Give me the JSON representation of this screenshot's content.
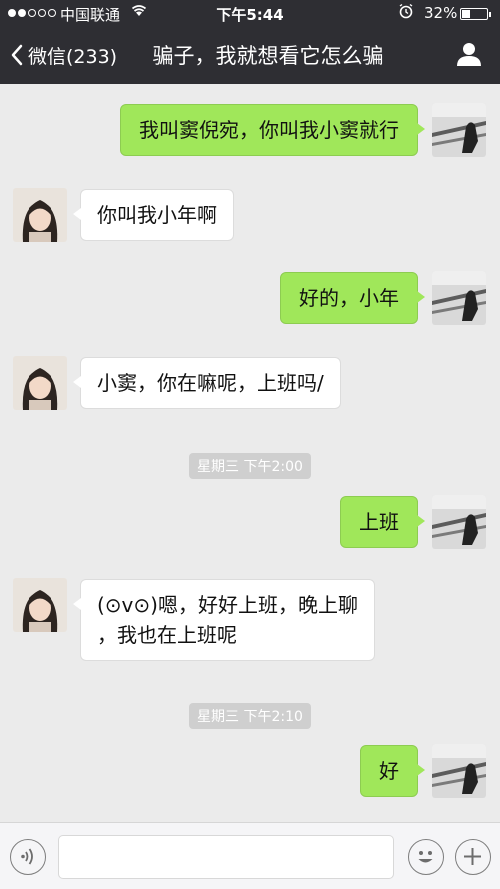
{
  "status": {
    "carrier": "中国联通",
    "time": "下午5:44",
    "battery": "32%",
    "battery_level": 0.32
  },
  "nav": {
    "back_label": "微信(233)",
    "title": "骗子，我就想看它怎么骗"
  },
  "messages": [
    {
      "side": "me",
      "text": "我叫窦倪宛，你叫我小窦就行"
    },
    {
      "side": "them",
      "text": "你叫我小年啊"
    },
    {
      "side": "me",
      "text": "好的，小年"
    },
    {
      "side": "them",
      "text": "小窦，你在嘛呢，上班吗/"
    },
    {
      "type": "time",
      "text": "星期三 下午2:00"
    },
    {
      "side": "me",
      "text": "上班"
    },
    {
      "side": "them",
      "text": "(⊙v⊙)嗯，好好上班，晚上聊\n，我也在上班呢"
    },
    {
      "type": "time",
      "text": "星期三 下午2:10"
    },
    {
      "side": "me",
      "text": "好"
    }
  ],
  "colors": {
    "nav_bg": "#2e2e33",
    "chat_bg": "#ebebeb",
    "my_bubble": "#a0e75a",
    "their_bubble": "#ffffff"
  },
  "icons": [
    "back-chevron-icon",
    "person-icon",
    "voice-icon",
    "emoji-icon",
    "plus-icon",
    "wifi-icon",
    "alarm-icon",
    "battery-icon"
  ]
}
